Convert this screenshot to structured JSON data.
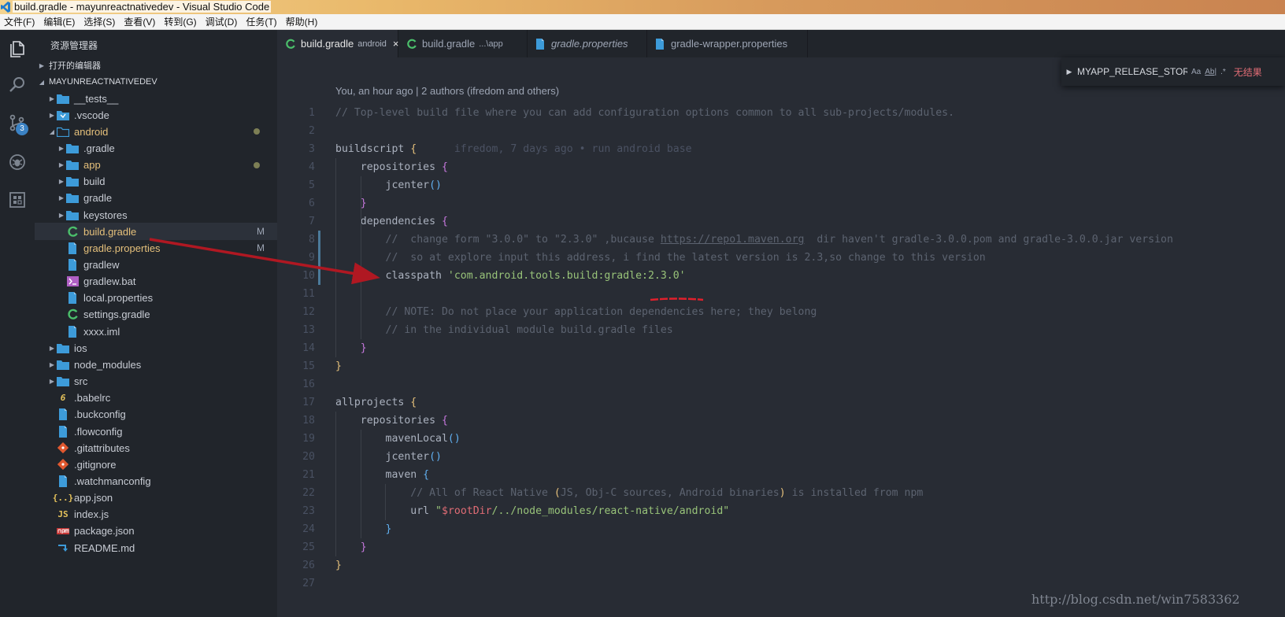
{
  "window": {
    "title": "build.gradle - mayunreactnativedev - Visual Studio Code"
  },
  "menu": [
    "文件(F)",
    "编辑(E)",
    "选择(S)",
    "查看(V)",
    "转到(G)",
    "调试(D)",
    "任务(T)",
    "帮助(H)"
  ],
  "activity": {
    "scm_badge": "3"
  },
  "sidebar": {
    "title": "资源管理器",
    "open_editors": "打开的编辑器",
    "workspace": "MAYUNREACTNATIVEDEV",
    "items": [
      {
        "label": "__tests__",
        "kind": "folder",
        "depth": 0,
        "chevron": "▶"
      },
      {
        "label": ".vscode",
        "kind": "vscode-folder",
        "depth": 0,
        "chevron": "▶"
      },
      {
        "label": "android",
        "kind": "folder-open",
        "depth": 0,
        "chevron": "◢",
        "modified": true,
        "dot": true
      },
      {
        "label": ".gradle",
        "kind": "folder",
        "depth": 1,
        "chevron": "▶"
      },
      {
        "label": "app",
        "kind": "folder",
        "depth": 1,
        "chevron": "▶",
        "modified": true,
        "dot": true
      },
      {
        "label": "build",
        "kind": "folder",
        "depth": 1,
        "chevron": "▶"
      },
      {
        "label": "gradle",
        "kind": "folder",
        "depth": 1,
        "chevron": "▶"
      },
      {
        "label": "keystores",
        "kind": "folder",
        "depth": 1,
        "chevron": "▶"
      },
      {
        "label": "build.gradle",
        "kind": "gradle",
        "depth": 1,
        "chevron": "",
        "modified": true,
        "status": "M",
        "selected": true
      },
      {
        "label": "gradle.properties",
        "kind": "file",
        "depth": 1,
        "chevron": "",
        "modified": true,
        "status": "M"
      },
      {
        "label": "gradlew",
        "kind": "file",
        "depth": 1,
        "chevron": ""
      },
      {
        "label": "gradlew.bat",
        "kind": "terminal",
        "depth": 1,
        "chevron": ""
      },
      {
        "label": "local.properties",
        "kind": "file",
        "depth": 1,
        "chevron": ""
      },
      {
        "label": "settings.gradle",
        "kind": "gradle",
        "depth": 1,
        "chevron": ""
      },
      {
        "label": "xxxx.iml",
        "kind": "file",
        "depth": 1,
        "chevron": ""
      },
      {
        "label": "ios",
        "kind": "folder",
        "depth": 0,
        "chevron": "▶"
      },
      {
        "label": "node_modules",
        "kind": "folder",
        "depth": 0,
        "chevron": "▶"
      },
      {
        "label": "src",
        "kind": "folder",
        "depth": 0,
        "chevron": "▶"
      },
      {
        "label": ".babelrc",
        "kind": "babel",
        "depth": 0,
        "chevron": ""
      },
      {
        "label": ".buckconfig",
        "kind": "file",
        "depth": 0,
        "chevron": ""
      },
      {
        "label": ".flowconfig",
        "kind": "file",
        "depth": 0,
        "chevron": ""
      },
      {
        "label": ".gitattributes",
        "kind": "git",
        "depth": 0,
        "chevron": ""
      },
      {
        "label": ".gitignore",
        "kind": "git",
        "depth": 0,
        "chevron": ""
      },
      {
        "label": ".watchmanconfig",
        "kind": "file",
        "depth": 0,
        "chevron": ""
      },
      {
        "label": "app.json",
        "kind": "json",
        "depth": 0,
        "chevron": ""
      },
      {
        "label": "index.js",
        "kind": "js",
        "depth": 0,
        "chevron": ""
      },
      {
        "label": "package.json",
        "kind": "npm",
        "depth": 0,
        "chevron": ""
      },
      {
        "label": "README.md",
        "kind": "md",
        "depth": 0,
        "chevron": ""
      }
    ]
  },
  "tabs": [
    {
      "name": "build.gradle",
      "desc": "android",
      "active": true,
      "icon": "gradle",
      "close": "×"
    },
    {
      "name": "build.gradle",
      "desc": "...\\app",
      "active": false,
      "icon": "gradle"
    },
    {
      "name": "gradle.properties",
      "desc": "",
      "active": false,
      "icon": "file",
      "italic": true
    },
    {
      "name": "gradle-wrapper.properties",
      "desc": "",
      "active": false,
      "icon": "file"
    }
  ],
  "find": {
    "query": "MYAPP_RELEASE_STOR...",
    "opt_case": "Aa",
    "opt_word": "Ab|",
    "opt_regex": ".*",
    "result": "无结果"
  },
  "blame_top": "You, an hour ago | 2 authors (ifredom and others)",
  "blame_inline": "ifredom, 7 days ago • run android base",
  "code": [
    {
      "n": "1",
      "t": [
        [
          "cmt",
          "// Top-level build file where you can add configuration options common to all sub-projects/modules."
        ]
      ]
    },
    {
      "n": "2",
      "t": []
    },
    {
      "n": "3",
      "t": [
        [
          "kw",
          "buildscript "
        ],
        [
          "br1",
          "{"
        ],
        [
          "blame",
          "      ifredom, 7 days ago • run android base"
        ]
      ]
    },
    {
      "n": "4",
      "t": [
        [
          "kw",
          "    repositories "
        ],
        [
          "br2",
          "{"
        ]
      ]
    },
    {
      "n": "5",
      "t": [
        [
          "fn",
          "        jcenter"
        ],
        [
          "br3",
          "()"
        ]
      ]
    },
    {
      "n": "6",
      "t": [
        [
          "br2",
          "    }"
        ]
      ]
    },
    {
      "n": "7",
      "t": [
        [
          "kw",
          "    dependencies "
        ],
        [
          "br2",
          "{"
        ]
      ]
    },
    {
      "n": "8",
      "t": [
        [
          "cmt",
          "        //  change form \"3.0.0\" to \"2.3.0\" ,bucause "
        ],
        [
          "link",
          "https://repo1.maven.org"
        ],
        [
          "cmt",
          "  dir haven't gradle-3.0.0.pom and gradle-3.0.0.jar version"
        ]
      ]
    },
    {
      "n": "9",
      "t": [
        [
          "cmt",
          "        //  so at explore input this address, i find the latest version is 2.3,so change to this version"
        ]
      ]
    },
    {
      "n": "10",
      "t": [
        [
          "kw",
          "        classpath "
        ],
        [
          "str",
          "'com.android.tools.build:gradle:2.3.0'"
        ]
      ]
    },
    {
      "n": "11",
      "t": []
    },
    {
      "n": "12",
      "t": [
        [
          "cmt",
          "        // NOTE: Do not place your application dependencies here; they belong"
        ]
      ]
    },
    {
      "n": "13",
      "t": [
        [
          "cmt",
          "        // in the individual module build.gradle files"
        ]
      ]
    },
    {
      "n": "14",
      "t": [
        [
          "br2",
          "    }"
        ]
      ]
    },
    {
      "n": "15",
      "t": [
        [
          "br1",
          "}"
        ]
      ]
    },
    {
      "n": "16",
      "t": []
    },
    {
      "n": "17",
      "t": [
        [
          "kw",
          "allprojects "
        ],
        [
          "br1",
          "{"
        ]
      ]
    },
    {
      "n": "18",
      "t": [
        [
          "kw",
          "    repositories "
        ],
        [
          "br2",
          "{"
        ]
      ]
    },
    {
      "n": "19",
      "t": [
        [
          "fn",
          "        mavenLocal"
        ],
        [
          "br3",
          "()"
        ]
      ]
    },
    {
      "n": "20",
      "t": [
        [
          "fn",
          "        jcenter"
        ],
        [
          "br3",
          "()"
        ]
      ]
    },
    {
      "n": "21",
      "t": [
        [
          "kw",
          "        maven "
        ],
        [
          "br3",
          "{"
        ]
      ]
    },
    {
      "n": "22",
      "t": [
        [
          "cmt",
          "            // All of React Native "
        ],
        [
          "br1",
          "("
        ],
        [
          "cmt",
          "JS, Obj-C sources, Android binaries"
        ],
        [
          "br1",
          ")"
        ],
        [
          "cmt",
          " is installed from npm"
        ]
      ]
    },
    {
      "n": "23",
      "t": [
        [
          "kw",
          "            url "
        ],
        [
          "str",
          "\""
        ],
        [
          "var",
          "$rootDir"
        ],
        [
          "str",
          "/../node_modules/react-native/android\""
        ]
      ]
    },
    {
      "n": "24",
      "t": [
        [
          "br3",
          "        }"
        ]
      ]
    },
    {
      "n": "25",
      "t": [
        [
          "br2",
          "    }"
        ]
      ]
    },
    {
      "n": "26",
      "t": [
        [
          "br1",
          "}"
        ]
      ]
    },
    {
      "n": "27",
      "t": []
    }
  ],
  "watermark": "http://blog.csdn.net/win7583362",
  "colors": {
    "accent_red": "#c0202a",
    "folder_blue": "#3d9bd9",
    "gradle_green": "#4bbf6b"
  }
}
